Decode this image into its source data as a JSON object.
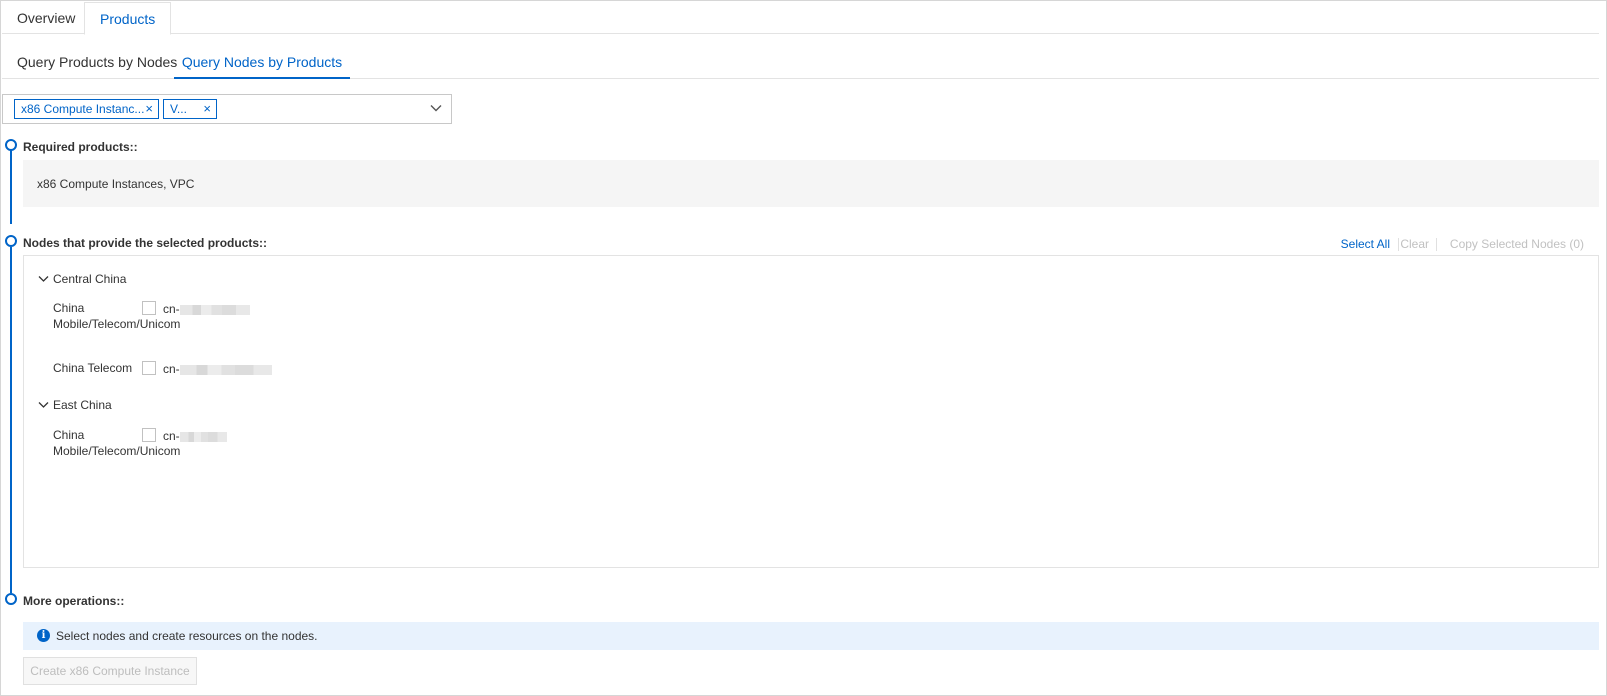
{
  "top_tabs": [
    "Overview",
    "Products"
  ],
  "sub_tabs": [
    "Query Products by Nodes",
    "Query Nodes by Products"
  ],
  "selector": {
    "tags": [
      "x86 Compute Instanc...",
      "V..."
    ],
    "remove_glyph": "×"
  },
  "steps": {
    "required": {
      "title": "Required products::",
      "value": "x86 Compute Instances, VPC"
    },
    "nodes": {
      "title": "Nodes that provide the selected products::",
      "actions": {
        "select_all": "Select All",
        "clear": "Clear",
        "copy": "Copy Selected Nodes (0)"
      },
      "regions": [
        {
          "name": "Central China",
          "rows": [
            {
              "isp": "China Mobile/Telecom/Unicom",
              "node_prefix": "cn-",
              "checked": false
            },
            {
              "isp": "China Telecom",
              "node_prefix": "cn-",
              "checked": false
            }
          ]
        },
        {
          "name": "East China",
          "rows": [
            {
              "isp": "China Mobile/Telecom/Unicom",
              "node_prefix": "cn-",
              "checked": false
            }
          ]
        }
      ]
    },
    "more": {
      "title": "More operations::",
      "info": "Select nodes and create resources on the nodes.",
      "create_button": "Create x86 Compute Instance"
    }
  },
  "colors": {
    "accent": "#0064c8",
    "info_bg": "#e8f2fd",
    "disabled_text": "#bdbdbd"
  },
  "icons": {
    "dropdown": "chevron-down-icon",
    "collapse": "chevron-down-icon",
    "info": "info-icon"
  }
}
